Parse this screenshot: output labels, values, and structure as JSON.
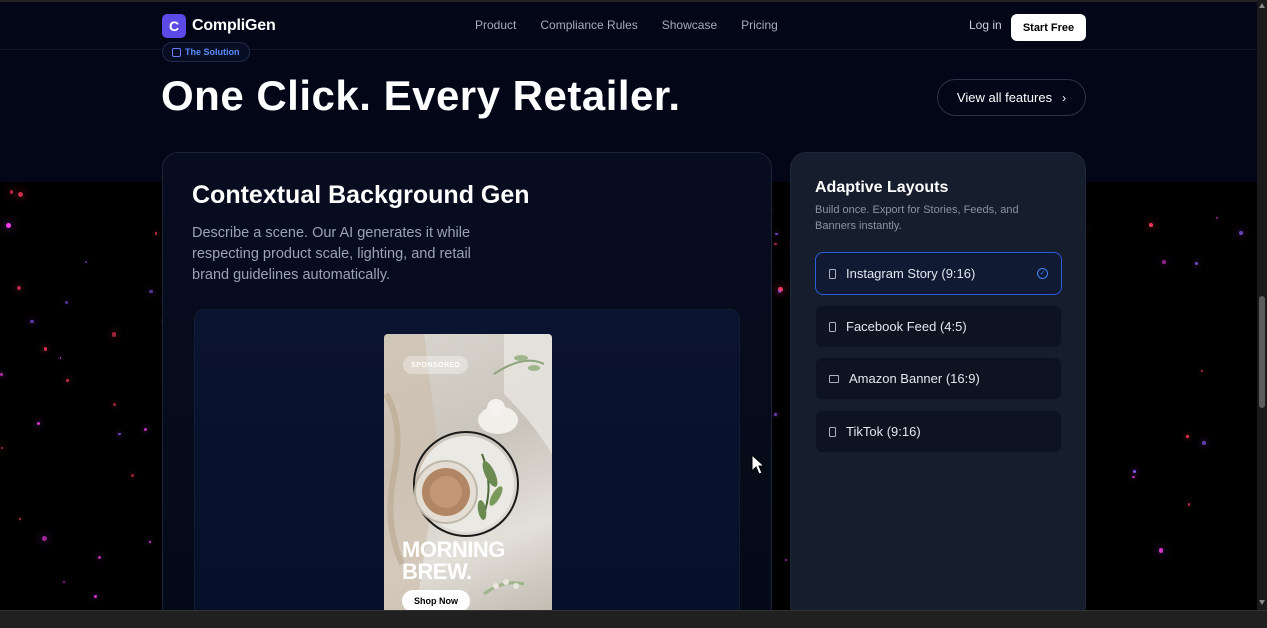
{
  "brand": {
    "logo_letter": "C",
    "name": "CompliGen"
  },
  "nav": {
    "links": [
      "Product",
      "Compliance Rules",
      "Showcase",
      "Pricing"
    ],
    "login": "Log in",
    "cta": "Start Free"
  },
  "hero": {
    "badge": "The Solution",
    "title": "One Click. Every Retailer.",
    "features_button": "View all features"
  },
  "feature_card": {
    "title": "Contextual Background Gen",
    "description": "Describe a scene. Our AI generates it while respecting product scale, lighting, and retail brand guidelines automatically.",
    "ad": {
      "tag": "SPONSORED",
      "headline_line1": "MORNING",
      "headline_line2": "BREW.",
      "cta": "Shop Now"
    }
  },
  "layouts_card": {
    "title": "Adaptive Layouts",
    "description": "Build once. Export for Stories, Feeds, and Banners instantly.",
    "options": [
      {
        "label": "Instagram Story (9:16)",
        "icon": "phone-icon",
        "selected": true
      },
      {
        "label": "Facebook Feed (4:5)",
        "icon": "phone-icon",
        "selected": false
      },
      {
        "label": "Amazon Banner (16:9)",
        "icon": "monitor-icon",
        "selected": false
      },
      {
        "label": "TikTok (9:16)",
        "icon": "phone-icon",
        "selected": false
      }
    ]
  },
  "colors": {
    "background": "#020617",
    "accent": "#5b4be6",
    "particle": "#ff3df2",
    "selected_border": "#2d5bd9"
  }
}
